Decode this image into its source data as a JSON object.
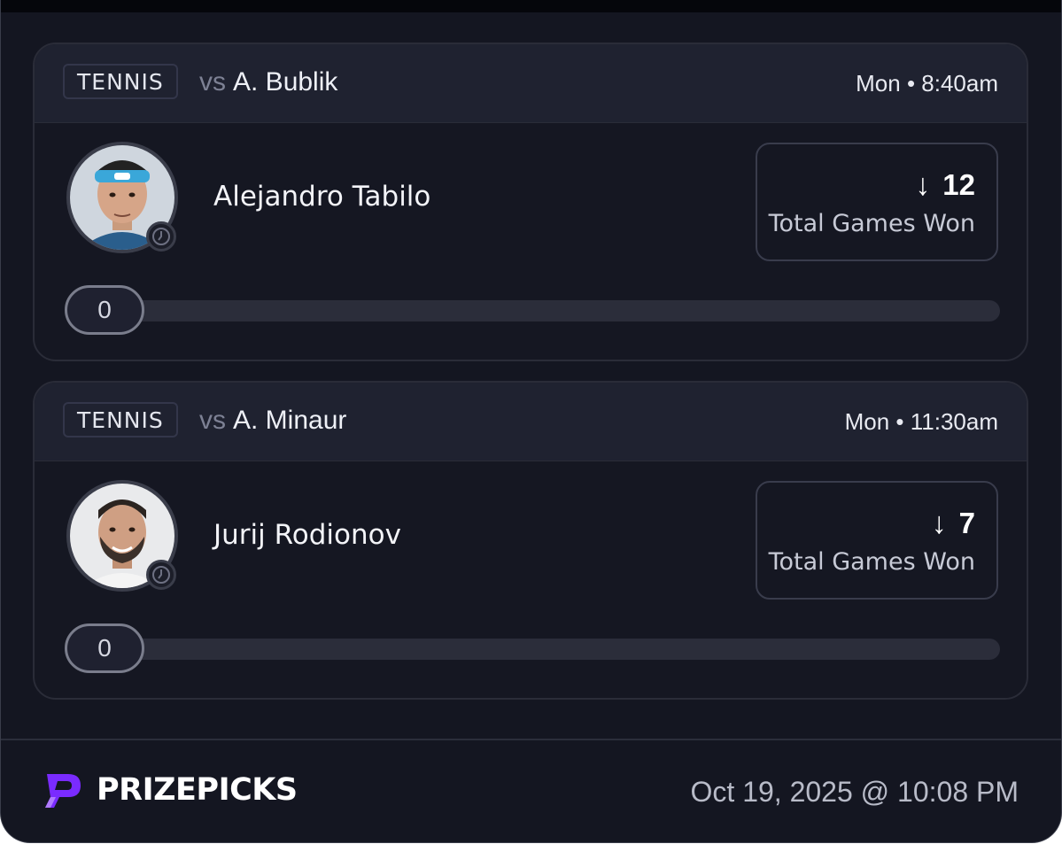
{
  "brand": {
    "name": "PRIZEPICKS",
    "accent": "#7a2bff"
  },
  "timestamp": "Oct 19, 2025 @ 10:08 PM",
  "picks": [
    {
      "sport": "TENNIS",
      "vs_label": "vs",
      "opponent": "A. Bublik",
      "time": "Mon • 8:40am",
      "player": "Alejandro Tabilo",
      "direction": "down",
      "line": "12",
      "stat": "Total Games Won",
      "progress_value": "0",
      "progress_fraction": 0
    },
    {
      "sport": "TENNIS",
      "vs_label": "vs",
      "opponent": "A. Minaur",
      "time": "Mon • 11:30am",
      "player": "Jurij Rodionov",
      "direction": "down",
      "line": "7",
      "stat": "Total Games Won",
      "progress_value": "0",
      "progress_fraction": 0
    }
  ]
}
